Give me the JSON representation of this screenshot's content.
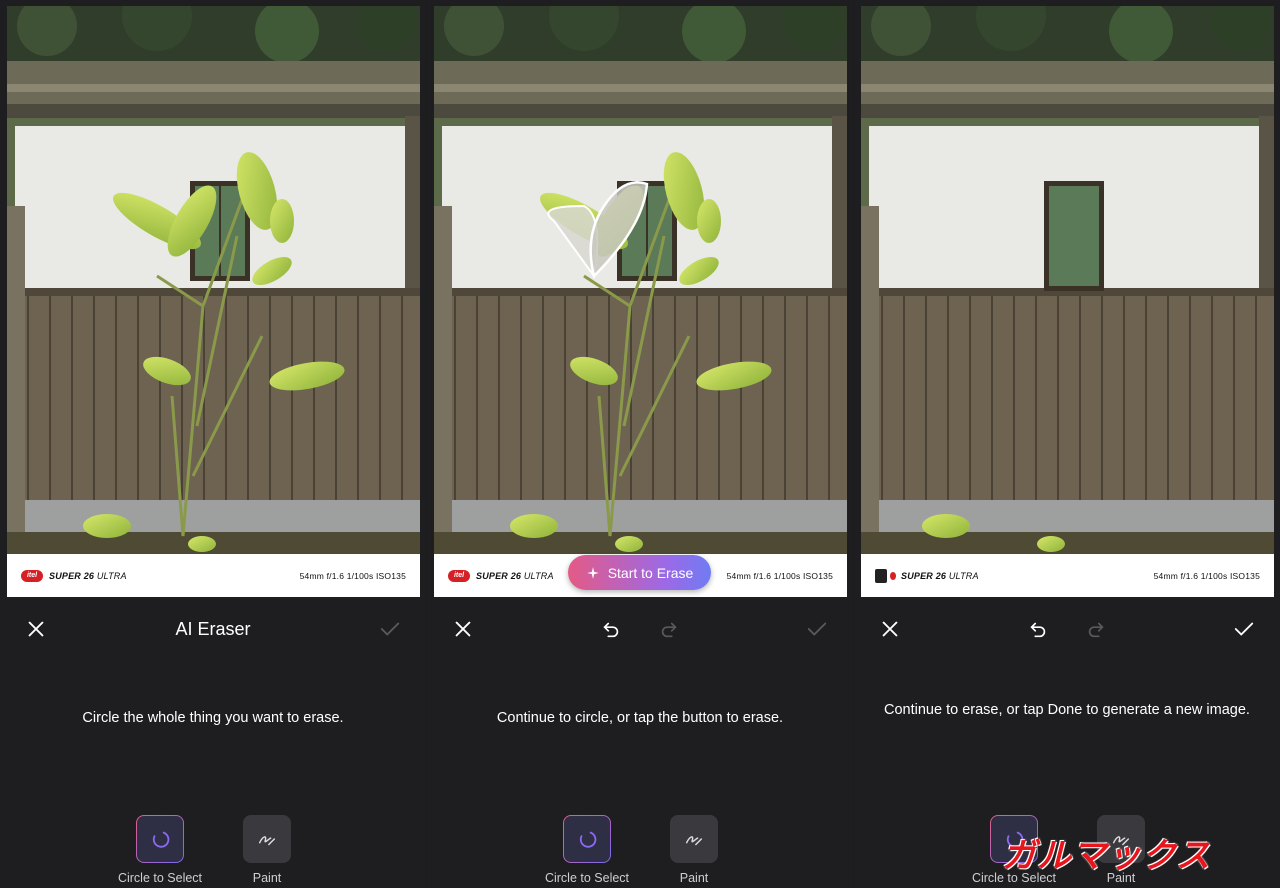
{
  "panels": [
    {
      "title": "AI Eraser",
      "instruction": "Circle the whole thing you want to erase.",
      "photo_strip": {
        "brand": "itel",
        "model": "SUPER 26",
        "model_suffix": "ULTRA",
        "exif": "54mm  f/1.6  1/100s  ISO135"
      },
      "tools": [
        {
          "label": "Circle to Select",
          "selected": true
        },
        {
          "label": "Paint",
          "selected": false
        }
      ],
      "done_enabled": false
    },
    {
      "instruction": "Continue to circle, or tap the button to erase.",
      "erase_button": "Start to Erase",
      "photo_strip": {
        "brand": "itel",
        "model": "SUPER 26",
        "model_suffix": "ULTRA",
        "exif": "54mm  f/1.6  1/100s  ISO135"
      },
      "tools": [
        {
          "label": "Circle to Select",
          "selected": true
        },
        {
          "label": "Paint",
          "selected": false
        }
      ],
      "done_enabled": false
    },
    {
      "instruction": "Continue to erase, or tap Done to generate a new image.",
      "photo_strip": {
        "model": "SUPER 26",
        "model_suffix": "ULTRA",
        "exif": "54mm  f/1.6  1/100s  ISO135"
      },
      "tools": [
        {
          "label": "Circle to Select",
          "selected": true
        },
        {
          "label": "Paint",
          "selected": false
        }
      ],
      "done_enabled": true
    }
  ],
  "watermark": "ガルマックス",
  "colors": {
    "sheet_bg": "#1e1e20",
    "accent_start": "#e45a86",
    "accent_end": "#6f7cf2"
  }
}
